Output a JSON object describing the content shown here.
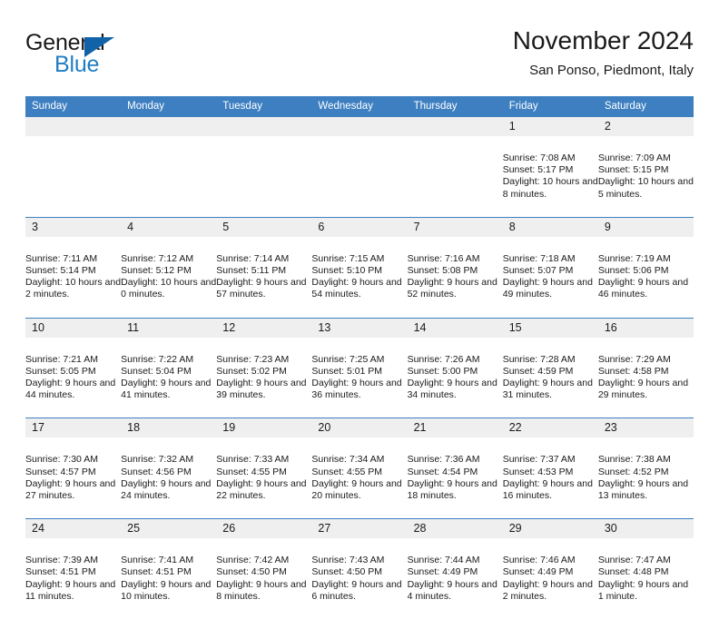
{
  "brand": {
    "name_part1": "General",
    "name_part2": "Blue",
    "accent_color": "#1f7ec4",
    "triangle_color": "#1262a8"
  },
  "header": {
    "title": "November 2024",
    "subtitle": "San Ponso, Piedmont, Italy"
  },
  "theme": {
    "header_bar_color": "#3d7fc1",
    "daynum_bg": "#efefef",
    "text_color": "#1a1a1a"
  },
  "weekday_headers": [
    "Sunday",
    "Monday",
    "Tuesday",
    "Wednesday",
    "Thursday",
    "Friday",
    "Saturday"
  ],
  "labels": {
    "sunrise_prefix": "Sunrise:",
    "sunset_prefix": "Sunset:",
    "daylight_prefix": "Daylight:"
  },
  "weeks": [
    [
      {
        "day": "",
        "sunrise": "",
        "sunset": "",
        "daylight": ""
      },
      {
        "day": "",
        "sunrise": "",
        "sunset": "",
        "daylight": ""
      },
      {
        "day": "",
        "sunrise": "",
        "sunset": "",
        "daylight": ""
      },
      {
        "day": "",
        "sunrise": "",
        "sunset": "",
        "daylight": ""
      },
      {
        "day": "",
        "sunrise": "",
        "sunset": "",
        "daylight": ""
      },
      {
        "day": "1",
        "sunrise": "Sunrise: 7:08 AM",
        "sunset": "Sunset: 5:17 PM",
        "daylight": "Daylight: 10 hours and 8 minutes."
      },
      {
        "day": "2",
        "sunrise": "Sunrise: 7:09 AM",
        "sunset": "Sunset: 5:15 PM",
        "daylight": "Daylight: 10 hours and 5 minutes."
      }
    ],
    [
      {
        "day": "3",
        "sunrise": "Sunrise: 7:11 AM",
        "sunset": "Sunset: 5:14 PM",
        "daylight": "Daylight: 10 hours and 2 minutes."
      },
      {
        "day": "4",
        "sunrise": "Sunrise: 7:12 AM",
        "sunset": "Sunset: 5:12 PM",
        "daylight": "Daylight: 10 hours and 0 minutes."
      },
      {
        "day": "5",
        "sunrise": "Sunrise: 7:14 AM",
        "sunset": "Sunset: 5:11 PM",
        "daylight": "Daylight: 9 hours and 57 minutes."
      },
      {
        "day": "6",
        "sunrise": "Sunrise: 7:15 AM",
        "sunset": "Sunset: 5:10 PM",
        "daylight": "Daylight: 9 hours and 54 minutes."
      },
      {
        "day": "7",
        "sunrise": "Sunrise: 7:16 AM",
        "sunset": "Sunset: 5:08 PM",
        "daylight": "Daylight: 9 hours and 52 minutes."
      },
      {
        "day": "8",
        "sunrise": "Sunrise: 7:18 AM",
        "sunset": "Sunset: 5:07 PM",
        "daylight": "Daylight: 9 hours and 49 minutes."
      },
      {
        "day": "9",
        "sunrise": "Sunrise: 7:19 AM",
        "sunset": "Sunset: 5:06 PM",
        "daylight": "Daylight: 9 hours and 46 minutes."
      }
    ],
    [
      {
        "day": "10",
        "sunrise": "Sunrise: 7:21 AM",
        "sunset": "Sunset: 5:05 PM",
        "daylight": "Daylight: 9 hours and 44 minutes."
      },
      {
        "day": "11",
        "sunrise": "Sunrise: 7:22 AM",
        "sunset": "Sunset: 5:04 PM",
        "daylight": "Daylight: 9 hours and 41 minutes."
      },
      {
        "day": "12",
        "sunrise": "Sunrise: 7:23 AM",
        "sunset": "Sunset: 5:02 PM",
        "daylight": "Daylight: 9 hours and 39 minutes."
      },
      {
        "day": "13",
        "sunrise": "Sunrise: 7:25 AM",
        "sunset": "Sunset: 5:01 PM",
        "daylight": "Daylight: 9 hours and 36 minutes."
      },
      {
        "day": "14",
        "sunrise": "Sunrise: 7:26 AM",
        "sunset": "Sunset: 5:00 PM",
        "daylight": "Daylight: 9 hours and 34 minutes."
      },
      {
        "day": "15",
        "sunrise": "Sunrise: 7:28 AM",
        "sunset": "Sunset: 4:59 PM",
        "daylight": "Daylight: 9 hours and 31 minutes."
      },
      {
        "day": "16",
        "sunrise": "Sunrise: 7:29 AM",
        "sunset": "Sunset: 4:58 PM",
        "daylight": "Daylight: 9 hours and 29 minutes."
      }
    ],
    [
      {
        "day": "17",
        "sunrise": "Sunrise: 7:30 AM",
        "sunset": "Sunset: 4:57 PM",
        "daylight": "Daylight: 9 hours and 27 minutes."
      },
      {
        "day": "18",
        "sunrise": "Sunrise: 7:32 AM",
        "sunset": "Sunset: 4:56 PM",
        "daylight": "Daylight: 9 hours and 24 minutes."
      },
      {
        "day": "19",
        "sunrise": "Sunrise: 7:33 AM",
        "sunset": "Sunset: 4:55 PM",
        "daylight": "Daylight: 9 hours and 22 minutes."
      },
      {
        "day": "20",
        "sunrise": "Sunrise: 7:34 AM",
        "sunset": "Sunset: 4:55 PM",
        "daylight": "Daylight: 9 hours and 20 minutes."
      },
      {
        "day": "21",
        "sunrise": "Sunrise: 7:36 AM",
        "sunset": "Sunset: 4:54 PM",
        "daylight": "Daylight: 9 hours and 18 minutes."
      },
      {
        "day": "22",
        "sunrise": "Sunrise: 7:37 AM",
        "sunset": "Sunset: 4:53 PM",
        "daylight": "Daylight: 9 hours and 16 minutes."
      },
      {
        "day": "23",
        "sunrise": "Sunrise: 7:38 AM",
        "sunset": "Sunset: 4:52 PM",
        "daylight": "Daylight: 9 hours and 13 minutes."
      }
    ],
    [
      {
        "day": "24",
        "sunrise": "Sunrise: 7:39 AM",
        "sunset": "Sunset: 4:51 PM",
        "daylight": "Daylight: 9 hours and 11 minutes."
      },
      {
        "day": "25",
        "sunrise": "Sunrise: 7:41 AM",
        "sunset": "Sunset: 4:51 PM",
        "daylight": "Daylight: 9 hours and 10 minutes."
      },
      {
        "day": "26",
        "sunrise": "Sunrise: 7:42 AM",
        "sunset": "Sunset: 4:50 PM",
        "daylight": "Daylight: 9 hours and 8 minutes."
      },
      {
        "day": "27",
        "sunrise": "Sunrise: 7:43 AM",
        "sunset": "Sunset: 4:50 PM",
        "daylight": "Daylight: 9 hours and 6 minutes."
      },
      {
        "day": "28",
        "sunrise": "Sunrise: 7:44 AM",
        "sunset": "Sunset: 4:49 PM",
        "daylight": "Daylight: 9 hours and 4 minutes."
      },
      {
        "day": "29",
        "sunrise": "Sunrise: 7:46 AM",
        "sunset": "Sunset: 4:49 PM",
        "daylight": "Daylight: 9 hours and 2 minutes."
      },
      {
        "day": "30",
        "sunrise": "Sunrise: 7:47 AM",
        "sunset": "Sunset: 4:48 PM",
        "daylight": "Daylight: 9 hours and 1 minute."
      }
    ]
  ]
}
